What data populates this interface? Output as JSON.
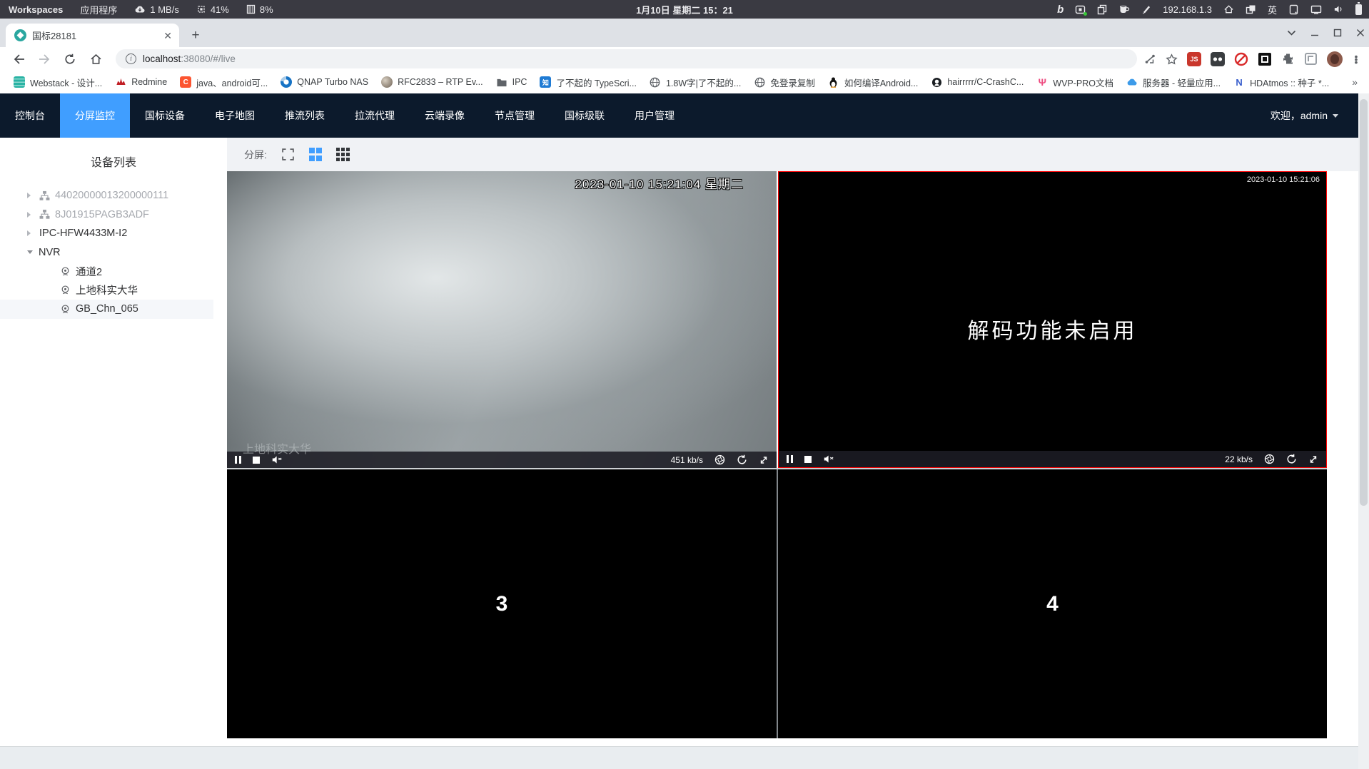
{
  "colors": {
    "accent": "#409eff",
    "nav_background": "#0c1a2c",
    "selected_cell_border": "#ff0000",
    "favicon_teal": "#2aa7a0",
    "player_bar": "#1c1c24"
  },
  "system_bar": {
    "workspaces": "Workspaces",
    "applications": "应用程序",
    "net_speed": "1 MB/s",
    "cpu_usage": "41%",
    "mem_usage": "8%",
    "clock": "1月10日 星期二 15：21",
    "ip_address": "192.168.1.3",
    "input_lang": "英"
  },
  "browser": {
    "tab_title": "国标28181",
    "url_host": "localhost",
    "url_rest": ":38080/#/live",
    "bookmarks": [
      {
        "label": "Webstack - 设计...",
        "icon": "webstack-icon"
      },
      {
        "label": "Redmine",
        "icon": "redmine-icon"
      },
      {
        "label": "java、android可...",
        "icon": "csdn-icon"
      },
      {
        "label": "QNAP Turbo NAS",
        "icon": "qnap-icon"
      },
      {
        "label": "RFC2833 – RTP Ev...",
        "icon": "globe-photo-icon"
      },
      {
        "label": "IPC",
        "icon": "folder-icon"
      },
      {
        "label": "了不起的 TypeScri...",
        "icon": "zhihu-icon"
      },
      {
        "label": "1.8W字|了不起的...",
        "icon": "globe-icon"
      },
      {
        "label": "免登录复制",
        "icon": "globe-icon"
      },
      {
        "label": "如何编译Android...",
        "icon": "penguin-icon"
      },
      {
        "label": "hairrrrr/C-CrashC...",
        "icon": "github-icon"
      },
      {
        "label": "WVP-PRO文档",
        "icon": "wvp-icon"
      },
      {
        "label": "服务器 - 轻量应用...",
        "icon": "cloud-icon"
      },
      {
        "label": "HDAtmos :: 种子 *...",
        "icon": "hdatmos-icon"
      }
    ],
    "bookmarks_overflow": "»",
    "csdn_letter": "C",
    "zhihu_char": "知",
    "js_badge": "JS",
    "wvp_glyph": "Ψ",
    "hdatmos_glyph": "N"
  },
  "nav": {
    "items": [
      "控制台",
      "分屏监控",
      "国标设备",
      "电子地图",
      "推流列表",
      "拉流代理",
      "云端录像",
      "节点管理",
      "国标级联",
      "用户管理"
    ],
    "active": "分屏监控",
    "welcome": "欢迎，admin"
  },
  "sidebar": {
    "title": "设备列表",
    "tree": [
      {
        "label": "44020000013200000111",
        "type": "platform",
        "muted": true
      },
      {
        "label": "8J01915PAGB3ADF",
        "type": "platform",
        "muted": true
      },
      {
        "label": "IPC-HFW4433M-I2",
        "type": "device",
        "muted": false
      },
      {
        "label": "NVR",
        "type": "device",
        "expanded": true
      },
      {
        "label": "通道2",
        "type": "channel"
      },
      {
        "label": "上地科实大华",
        "type": "channel"
      },
      {
        "label": "GB_Chn_065",
        "type": "channel",
        "selected": true
      }
    ]
  },
  "toolbar": {
    "split_label": "分屏:"
  },
  "players": {
    "cell1": {
      "timestamp": "2023-01-10 15:21:04 星期二",
      "watermark": "上地科实大华",
      "bitrate": "451 kb/s"
    },
    "cell2": {
      "timestamp": "2023-01-10 15:21:06",
      "message": "解码功能未启用",
      "bitrate": "22 kb/s"
    },
    "cell3": {
      "number": "3"
    },
    "cell4": {
      "number": "4"
    }
  }
}
